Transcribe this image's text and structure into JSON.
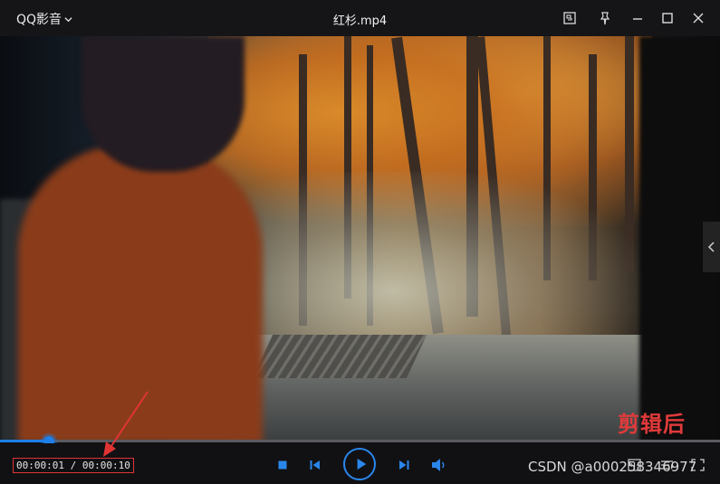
{
  "titlebar": {
    "app_name": "QQ影音",
    "file_name": "红杉.mp4",
    "icons": [
      "screenshot-icon",
      "pin-icon",
      "minimize-icon",
      "maximize-icon",
      "close-icon"
    ]
  },
  "video": {
    "overlay_caption": "剪辑后",
    "side_panel_icon": "chevron-left-icon"
  },
  "progress": {
    "current": "00:00:01",
    "total": "00:00:10",
    "played_fraction": 0.068,
    "played_color": "#1e7fe8"
  },
  "controls": {
    "time_display": "00:00:01 / 00:00:10",
    "icons": [
      "stop-icon",
      "previous-icon",
      "play-icon",
      "next-icon",
      "volume-icon",
      "equalizer-icon",
      "playlist-icon",
      "fullscreen-icon"
    ]
  },
  "watermark": "CSDN @a000258346977",
  "colors": {
    "accent": "#1e7fe8",
    "annotation": "#e03434",
    "caption": "#e03a3a"
  }
}
